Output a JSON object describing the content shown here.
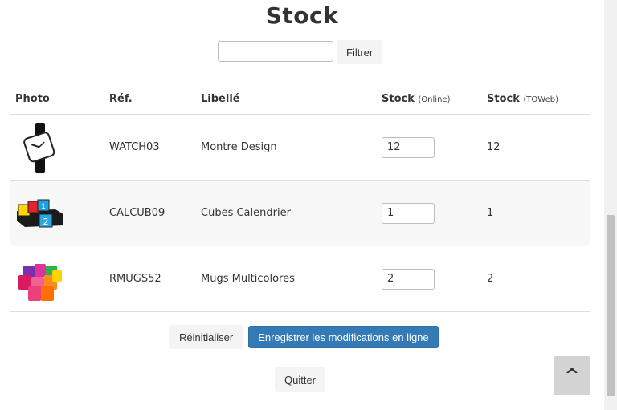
{
  "page": {
    "title": "Stock"
  },
  "filter": {
    "input_value": "",
    "button_label": "Filtrer"
  },
  "table": {
    "headers": {
      "photo": "Photo",
      "ref": "Réf.",
      "label": "Libellé",
      "stock_online": "Stock",
      "stock_online_sub": "(Online)",
      "stock_toweb": "Stock",
      "stock_toweb_sub": "(TOWeb)"
    },
    "rows": [
      {
        "photo_icon": "watch-icon",
        "ref": "WATCH03",
        "label": "Montre Design",
        "online": "12",
        "toweb": "12"
      },
      {
        "photo_icon": "calendar-cubes-icon",
        "ref": "CALCUB09",
        "label": "Cubes Calendrier",
        "online": "1",
        "toweb": "1"
      },
      {
        "photo_icon": "mugs-icon",
        "ref": "RMUGS52",
        "label": "Mugs Multicolores",
        "online": "2",
        "toweb": "2"
      }
    ]
  },
  "actions": {
    "reset_label": "Réinitialiser",
    "save_label": "Enregistrer les modifications en ligne",
    "quit_label": "Quitter"
  },
  "scroll_top": {
    "label": "^"
  },
  "colors": {
    "primary": "#337ab7",
    "row_alt": "#f7f7f7",
    "scroll_top_bg": "#d3d3d3"
  }
}
